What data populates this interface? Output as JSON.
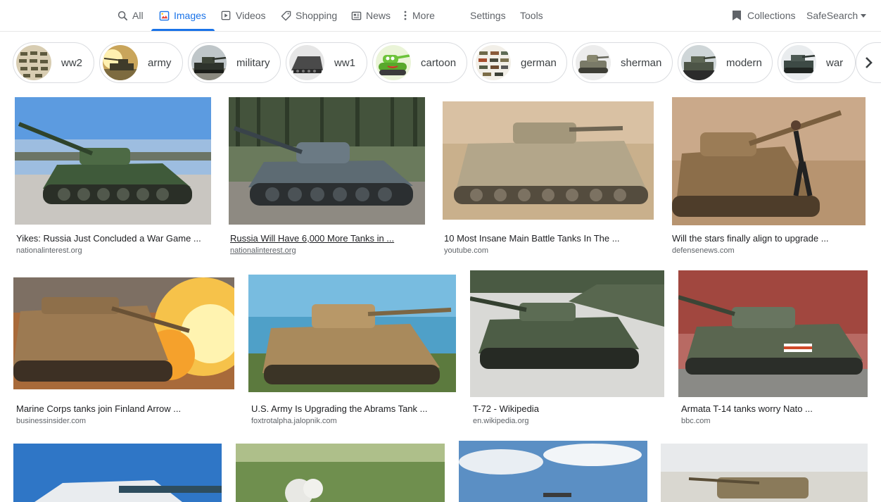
{
  "nav": {
    "tabs": [
      {
        "label": "All",
        "icon": "search-icon"
      },
      {
        "label": "Images",
        "icon": "image-icon",
        "active": true
      },
      {
        "label": "Videos",
        "icon": "play-icon"
      },
      {
        "label": "Shopping",
        "icon": "tag-icon"
      },
      {
        "label": "News",
        "icon": "newspaper-icon"
      },
      {
        "label": "More",
        "icon": "more-vert-icon"
      }
    ],
    "settings": "Settings",
    "tools": "Tools",
    "collections": "Collections",
    "safesearch": "SafeSearch"
  },
  "chips": [
    {
      "label": "ww2"
    },
    {
      "label": "army"
    },
    {
      "label": "military"
    },
    {
      "label": "ww1"
    },
    {
      "label": "cartoon"
    },
    {
      "label": "german"
    },
    {
      "label": "sherman"
    },
    {
      "label": "modern"
    },
    {
      "label": "war"
    }
  ],
  "results": [
    {
      "title": "Yikes: Russia Just Concluded a War Game ...",
      "source": "nationalinterest.org"
    },
    {
      "title": "Russia Will Have 6,000 More Tanks in ...",
      "source": "nationalinterest.org"
    },
    {
      "title": "10 Most Insane Main Battle Tanks In The ...",
      "source": "youtube.com"
    },
    {
      "title": "Will the stars finally align to upgrade ...",
      "source": "defensenews.com"
    },
    {
      "title": "Marine Corps tanks join Finland Arrow ...",
      "source": "businessinsider.com"
    },
    {
      "title": "U.S. Army Is Upgrading the Abrams Tank ...",
      "source": "foxtrotalpha.jalopnik.com"
    },
    {
      "title": "T-72 - Wikipedia",
      "source": "en.wikipedia.org"
    },
    {
      "title": "Armata T-14 tanks worry Nato ...",
      "source": "bbc.com"
    },
    {
      "title": "",
      "source": ""
    },
    {
      "title": "",
      "source": ""
    },
    {
      "title": "",
      "source": ""
    },
    {
      "title": "",
      "source": ""
    }
  ],
  "colors": {
    "accent": "#1a73e8",
    "text": "#202124",
    "muted": "#5f6368",
    "border": "#dadce0"
  }
}
